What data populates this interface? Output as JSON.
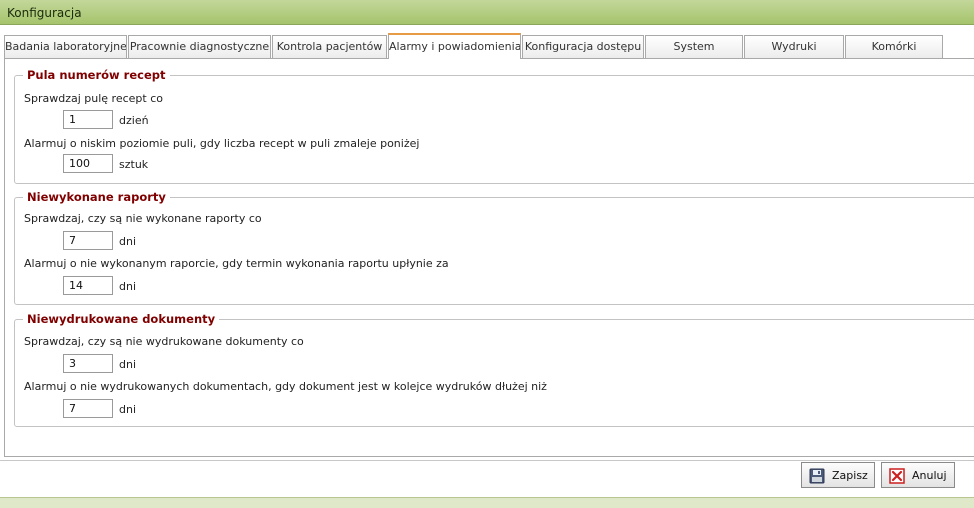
{
  "window": {
    "title": "Konfiguracja"
  },
  "tabs": [
    {
      "label": "Badania laboratoryjne"
    },
    {
      "label": "Pracownie diagnostyczne"
    },
    {
      "label": "Kontrola pacjentów"
    },
    {
      "label": "Alarmy i powiadomienia",
      "active": true
    },
    {
      "label": "Konfiguracja dostępu"
    },
    {
      "label": "System"
    },
    {
      "label": "Wydruki"
    },
    {
      "label": "Komórki"
    }
  ],
  "groups": [
    {
      "title": "Pula numerów recept",
      "check_label": "Sprawdzaj pulę recept co",
      "check_value": "1",
      "check_unit": "dzień",
      "alarm_label": "Alarmuj o niskim poziomie puli, gdy liczba recept w puli zmaleje poniżej",
      "alarm_value": "100",
      "alarm_unit": "sztuk"
    },
    {
      "title": "Niewykonane raporty",
      "check_label": "Sprawdzaj, czy są nie wykonane raporty co",
      "check_value": "7",
      "check_unit": "dni",
      "alarm_label": "Alarmuj o nie wykonanym raporcie, gdy termin wykonania raportu upłynie za",
      "alarm_value": "14",
      "alarm_unit": "dni"
    },
    {
      "title": "Niewydrukowane dokumenty",
      "check_label": "Sprawdzaj, czy są nie wydrukowane dokumenty co",
      "check_value": "3",
      "check_unit": "dni",
      "alarm_label": "Alarmuj o nie wydrukowanych dokumentach, gdy dokument jest w kolejce wydruków dłużej niż",
      "alarm_value": "7",
      "alarm_unit": "dni"
    }
  ],
  "buttons": {
    "save": {
      "label": "Zapisz",
      "icon": "floppy-disk-icon"
    },
    "cancel": {
      "label": "Anuluj",
      "icon": "cancel-x-icon"
    }
  },
  "colors": {
    "title_bar": "#a5c46c",
    "group_title": "#800000",
    "active_tab_accent": "#e79b44",
    "cancel_icon": "#cc1f1f"
  }
}
